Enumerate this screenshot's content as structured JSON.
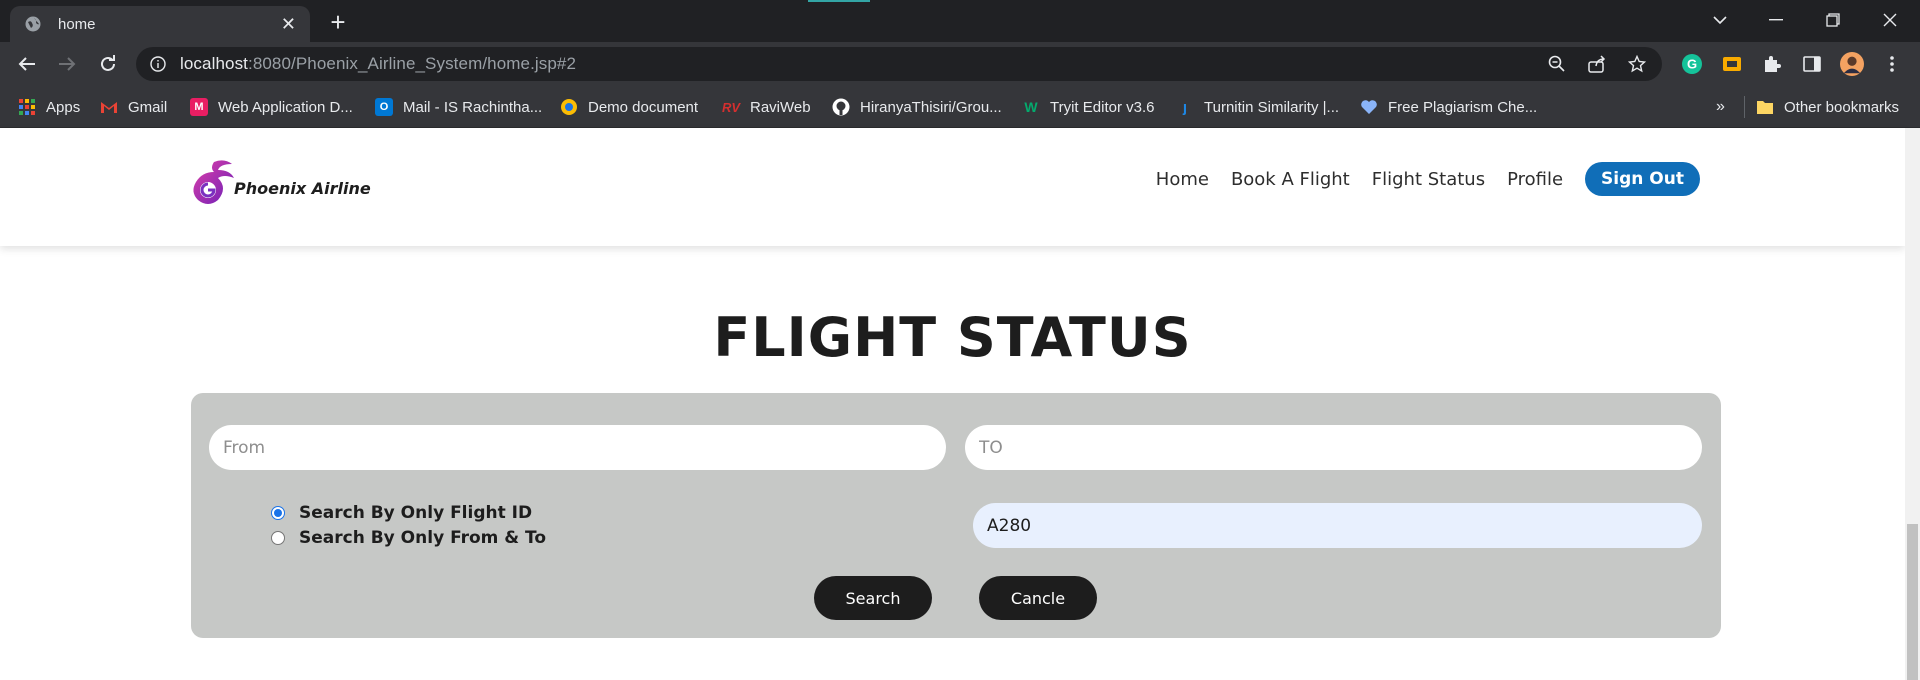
{
  "browser": {
    "tab_title": "home",
    "url_host": "localhost",
    "url_rest": ":8080/Phoenix_Airline_System/home.jsp#2",
    "bookmarks": [
      {
        "label": "Apps",
        "icon": "apps-grid-icon",
        "color": "#ea4335"
      },
      {
        "label": "Gmail",
        "icon": "gmail-icon",
        "color": "#ea4335"
      },
      {
        "label": "Web Application D...",
        "icon": "m-logo-icon",
        "color": "#e91e63"
      },
      {
        "label": "Mail - IS Rachintha...",
        "icon": "outlook-icon",
        "color": "#0078d4"
      },
      {
        "label": "Demo document",
        "icon": "demo-doc-icon",
        "color": "#fbbc04"
      },
      {
        "label": "RaviWeb",
        "icon": "raviweb-icon",
        "color": "#d32f2f"
      },
      {
        "label": "HiranyaThisiri/Grou...",
        "icon": "github-icon",
        "color": "#ffffff"
      },
      {
        "label": "Tryit Editor v3.6",
        "icon": "w3-icon",
        "color": "#04aa6d"
      },
      {
        "label": "Turnitin Similarity |...",
        "icon": "turnitin-icon",
        "color": "#1e88e5"
      },
      {
        "label": "Free Plagiarism Che...",
        "icon": "plagiarism-icon",
        "color": "#8ab4f8"
      }
    ],
    "more_bookmarks": "»",
    "other_bookmarks": "Other bookmarks"
  },
  "site": {
    "logo_text": "Phoenix Airline",
    "nav": {
      "home": "Home",
      "book": "Book A Flight",
      "status": "Flight Status",
      "profile": "Profile",
      "signout": "Sign Out"
    },
    "heading": "FLIGHT STATUS",
    "form": {
      "from_placeholder": "From",
      "to_placeholder": "TO",
      "flight_id_value": "A280",
      "radio_flight_id": "Search By Only Flight ID",
      "radio_from_to": "Search By Only From & To",
      "selected_radio": "flight_id",
      "search_label": "Search",
      "cancel_label": "Cancle"
    }
  },
  "colors": {
    "brand_blue": "#106eb8",
    "panel_gray": "#c6c8c6",
    "autofill_blue": "#e8f0fe"
  }
}
